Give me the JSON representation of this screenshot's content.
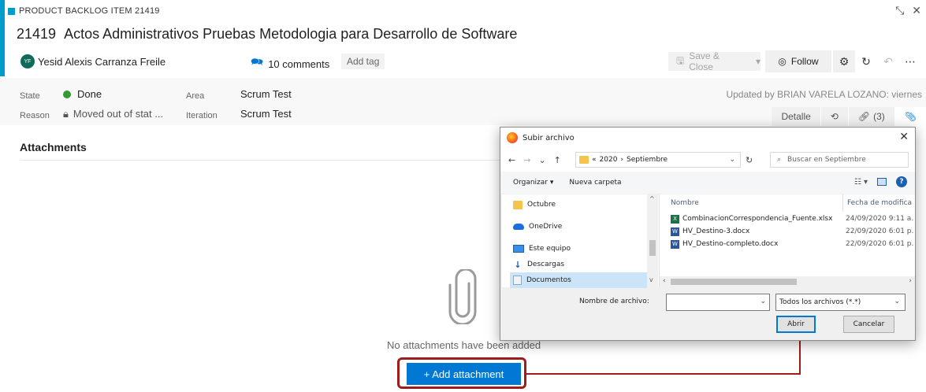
{
  "workitem": {
    "type_label": "PRODUCT BACKLOG ITEM 21419",
    "id": "21419",
    "title": "Actos Administrativos Pruebas Metodologia para Desarrollo de Software",
    "author_initials": "YF",
    "author": "Yesid Alexis Carranza Freile",
    "comments_label": "10 comments",
    "add_tag": "Add tag",
    "accent_color": "#009ccc"
  },
  "toolbar": {
    "save_close": "Save & Close",
    "follow": "Follow"
  },
  "fields": {
    "state_label": "State",
    "state_value": "Done",
    "reason_label": "Reason",
    "reason_value": "Moved out of stat ...",
    "area_label": "Area",
    "area_value": "Scrum Test",
    "iteration_label": "Iteration",
    "iteration_value": "Scrum Test",
    "updated": "Updated by BRIAN VARELA LOZANO: viernes"
  },
  "tabs": {
    "detalle": "Detalle",
    "links": "(3)"
  },
  "attachments": {
    "title": "Attachments",
    "empty_message": "No attachments have been added",
    "add_button": "+ Add attachment"
  },
  "dialog": {
    "title": "Subir archivo",
    "path_root": "«",
    "path_year": "2020",
    "path_month": "Septiembre",
    "search_placeholder": "Buscar en Septiembre",
    "organize": "Organizar ▾",
    "new_folder": "Nueva carpeta",
    "nav_items": [
      "Octubre",
      "OneDrive",
      "Este equipo",
      "Descargas",
      "Documentos"
    ],
    "col_name": "Nombre",
    "col_date": "Fecha de modifica",
    "files": [
      {
        "name": "CombinacionCorrespondencia_Fuente.xlsx",
        "date": "24/09/2020 9:11 a.",
        "kind": "xlsx"
      },
      {
        "name": "HV_Destino-3.docx",
        "date": "22/09/2020 6:01 p.",
        "kind": "docx"
      },
      {
        "name": "HV_Destino-completo.docx",
        "date": "22/09/2020 6:01 p.",
        "kind": "docx"
      }
    ],
    "filename_label": "Nombre de archivo:",
    "filetype": "Todos los archivos (*.*)",
    "open": "Abrir",
    "cancel": "Cancelar"
  }
}
